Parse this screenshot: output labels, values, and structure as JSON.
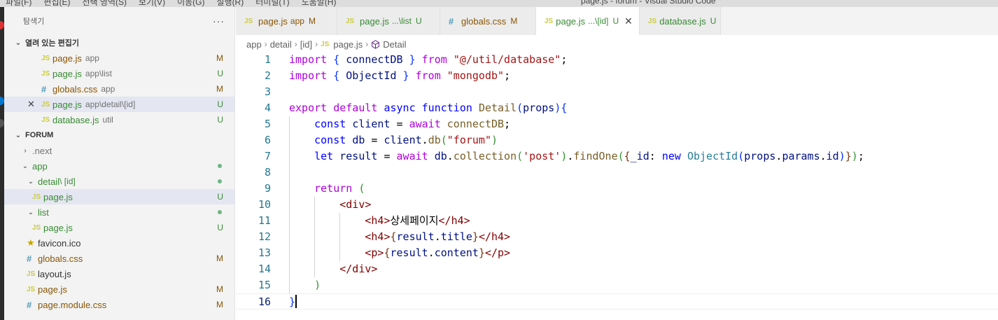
{
  "titlebar": {
    "menu": [
      "파일(F)",
      "편집(E)",
      "선택 영역(S)",
      "보기(V)",
      "이동(G)",
      "실행(R)",
      "터미널(T)",
      "도움말(H)"
    ],
    "window_title": "page.js - forum - Visual Studio Code"
  },
  "sidebar": {
    "title": "탐색기",
    "more": "···",
    "open_editors": {
      "label": "열려 있는 편집기",
      "items": [
        {
          "icon": "JS",
          "name": "page.js",
          "desc": "app",
          "badge": "M"
        },
        {
          "icon": "JS",
          "name": "page.js",
          "desc": "app\\list",
          "badge": "U"
        },
        {
          "icon": "#",
          "name": "globals.css",
          "desc": "app",
          "badge": "M"
        },
        {
          "icon": "JS",
          "name": "page.js",
          "desc": "app\\detail\\[id]",
          "badge": "U"
        },
        {
          "icon": "JS",
          "name": "database.js",
          "desc": "util",
          "badge": "U"
        }
      ]
    },
    "workspace": {
      "label": "FORUM",
      "items": [
        {
          "name": ".next"
        },
        {
          "name": "app"
        },
        {
          "name": "detail",
          "desc": "\\ [id]"
        },
        {
          "name": "page.js",
          "badge": "U"
        },
        {
          "name": "list"
        },
        {
          "name": "page.js",
          "badge": "U"
        },
        {
          "name": "favicon.ico"
        },
        {
          "name": "globals.css",
          "badge": "M"
        },
        {
          "name": "layout.js"
        },
        {
          "name": "page.js",
          "badge": "M"
        },
        {
          "name": "page.module.css",
          "badge": "M"
        }
      ]
    }
  },
  "tabs": [
    {
      "icon": "JS",
      "name": "page.js",
      "desc": "app",
      "badge": "M"
    },
    {
      "icon": "JS",
      "name": "page.js",
      "desc": "...\\list",
      "badge": "U"
    },
    {
      "icon": "#",
      "name": "globals.css",
      "desc": "",
      "badge": "M"
    },
    {
      "icon": "JS",
      "name": "page.js",
      "desc": "...\\[id]",
      "badge": "U",
      "close": "✕"
    },
    {
      "icon": "JS",
      "name": "database.js",
      "desc": "",
      "badge": "U"
    }
  ],
  "breadcrumb": {
    "parts": [
      "app",
      "detail",
      "[id]",
      "page.js",
      "Detail"
    ],
    "js_icon": "JS"
  },
  "editor": {
    "line_numbers": [
      "1",
      "2",
      "3",
      "4",
      "5",
      "6",
      "7",
      "8",
      "9",
      "10",
      "11",
      "12",
      "13",
      "14",
      "15",
      "16"
    ],
    "lines": [
      [
        [
          "k-purple",
          "import"
        ],
        [
          "k-plain",
          " "
        ],
        [
          "k-br1",
          "{"
        ],
        [
          "k-var",
          " connectDB "
        ],
        [
          "k-br1",
          "}"
        ],
        [
          "k-plain",
          " "
        ],
        [
          "k-purple",
          "from"
        ],
        [
          "k-plain",
          " "
        ],
        [
          "k-str",
          "\"@/util/database\""
        ],
        [
          "k-plain",
          ";"
        ]
      ],
      [
        [
          "k-purple",
          "import"
        ],
        [
          "k-plain",
          " "
        ],
        [
          "k-br1",
          "{"
        ],
        [
          "k-var",
          " ObjectId "
        ],
        [
          "k-br1",
          "}"
        ],
        [
          "k-plain",
          " "
        ],
        [
          "k-purple",
          "from"
        ],
        [
          "k-plain",
          " "
        ],
        [
          "k-str",
          "\"mongodb\""
        ],
        [
          "k-plain",
          ";"
        ]
      ],
      [],
      [
        [
          "k-purple",
          "export"
        ],
        [
          "k-plain",
          " "
        ],
        [
          "k-purple",
          "default"
        ],
        [
          "k-plain",
          " "
        ],
        [
          "k-blue",
          "async"
        ],
        [
          "k-plain",
          " "
        ],
        [
          "k-blue",
          "function"
        ],
        [
          "k-plain",
          " "
        ],
        [
          "k-fn",
          "Detail"
        ],
        [
          "k-br1",
          "("
        ],
        [
          "k-var",
          "props"
        ],
        [
          "k-br1",
          ")"
        ],
        [
          "k-br1",
          "{"
        ]
      ],
      [
        [
          "k-plain",
          "    "
        ],
        [
          "k-blue",
          "const"
        ],
        [
          "k-plain",
          " "
        ],
        [
          "k-var",
          "client"
        ],
        [
          "k-plain",
          " = "
        ],
        [
          "k-purple",
          "await"
        ],
        [
          "k-plain",
          " "
        ],
        [
          "k-fn",
          "connectDB"
        ],
        [
          "k-plain",
          ";"
        ]
      ],
      [
        [
          "k-plain",
          "    "
        ],
        [
          "k-blue",
          "const"
        ],
        [
          "k-plain",
          " "
        ],
        [
          "k-var",
          "db"
        ],
        [
          "k-plain",
          " = "
        ],
        [
          "k-var",
          "client"
        ],
        [
          "k-plain",
          "."
        ],
        [
          "k-fn",
          "db"
        ],
        [
          "k-br2",
          "("
        ],
        [
          "k-str",
          "\"forum\""
        ],
        [
          "k-br2",
          ")"
        ]
      ],
      [
        [
          "k-plain",
          "    "
        ],
        [
          "k-blue",
          "let"
        ],
        [
          "k-plain",
          " "
        ],
        [
          "k-var",
          "result"
        ],
        [
          "k-plain",
          " = "
        ],
        [
          "k-purple",
          "await"
        ],
        [
          "k-plain",
          " "
        ],
        [
          "k-var",
          "db"
        ],
        [
          "k-plain",
          "."
        ],
        [
          "k-fn",
          "collection"
        ],
        [
          "k-br2",
          "("
        ],
        [
          "k-str",
          "'post'"
        ],
        [
          "k-br2",
          ")"
        ],
        [
          "k-plain",
          "."
        ],
        [
          "k-fn",
          "findOne"
        ],
        [
          "k-br2",
          "("
        ],
        [
          "k-br3",
          "{"
        ],
        [
          "k-var",
          "_id"
        ],
        [
          "k-plain",
          ": "
        ],
        [
          "k-blue",
          "new"
        ],
        [
          "k-plain",
          " "
        ],
        [
          "k-type",
          "ObjectId"
        ],
        [
          "k-br1",
          "("
        ],
        [
          "k-var",
          "props"
        ],
        [
          "k-plain",
          "."
        ],
        [
          "k-var",
          "params"
        ],
        [
          "k-plain",
          "."
        ],
        [
          "k-var",
          "id"
        ],
        [
          "k-br1",
          ")"
        ],
        [
          "k-br3",
          "}"
        ],
        [
          "k-br2",
          ")"
        ],
        [
          "k-plain",
          ";"
        ]
      ],
      [],
      [
        [
          "k-plain",
          "    "
        ],
        [
          "k-purple",
          "return"
        ],
        [
          "k-plain",
          " "
        ],
        [
          "k-br2",
          "("
        ]
      ],
      [
        [
          "k-plain",
          "        "
        ],
        [
          "k-tag",
          "<div>"
        ]
      ],
      [
        [
          "k-plain",
          "            "
        ],
        [
          "k-tag",
          "<h4>"
        ],
        [
          "k-plain",
          "상세페이지"
        ],
        [
          "k-tag",
          "</h4>"
        ]
      ],
      [
        [
          "k-plain",
          "            "
        ],
        [
          "k-tag",
          "<h4>"
        ],
        [
          "k-br3",
          "{"
        ],
        [
          "k-var",
          "result"
        ],
        [
          "k-plain",
          "."
        ],
        [
          "k-var",
          "title"
        ],
        [
          "k-br3",
          "}"
        ],
        [
          "k-tag",
          "</h4>"
        ]
      ],
      [
        [
          "k-plain",
          "            "
        ],
        [
          "k-tag",
          "<p>"
        ],
        [
          "k-br3",
          "{"
        ],
        [
          "k-var",
          "result"
        ],
        [
          "k-plain",
          "."
        ],
        [
          "k-var",
          "content"
        ],
        [
          "k-br3",
          "}"
        ],
        [
          "k-tag",
          "</p>"
        ]
      ],
      [
        [
          "k-plain",
          "        "
        ],
        [
          "k-tag",
          "</div>"
        ]
      ],
      [
        [
          "k-plain",
          "    "
        ],
        [
          "k-br2",
          ")"
        ]
      ],
      [
        [
          "k-br1",
          "}"
        ]
      ]
    ],
    "current_line": 16
  },
  "colors": {
    "modified": "#895503",
    "untracked": "#388a34",
    "selection_row": "#e4e6f1",
    "activity_accent": "#0078d4"
  }
}
